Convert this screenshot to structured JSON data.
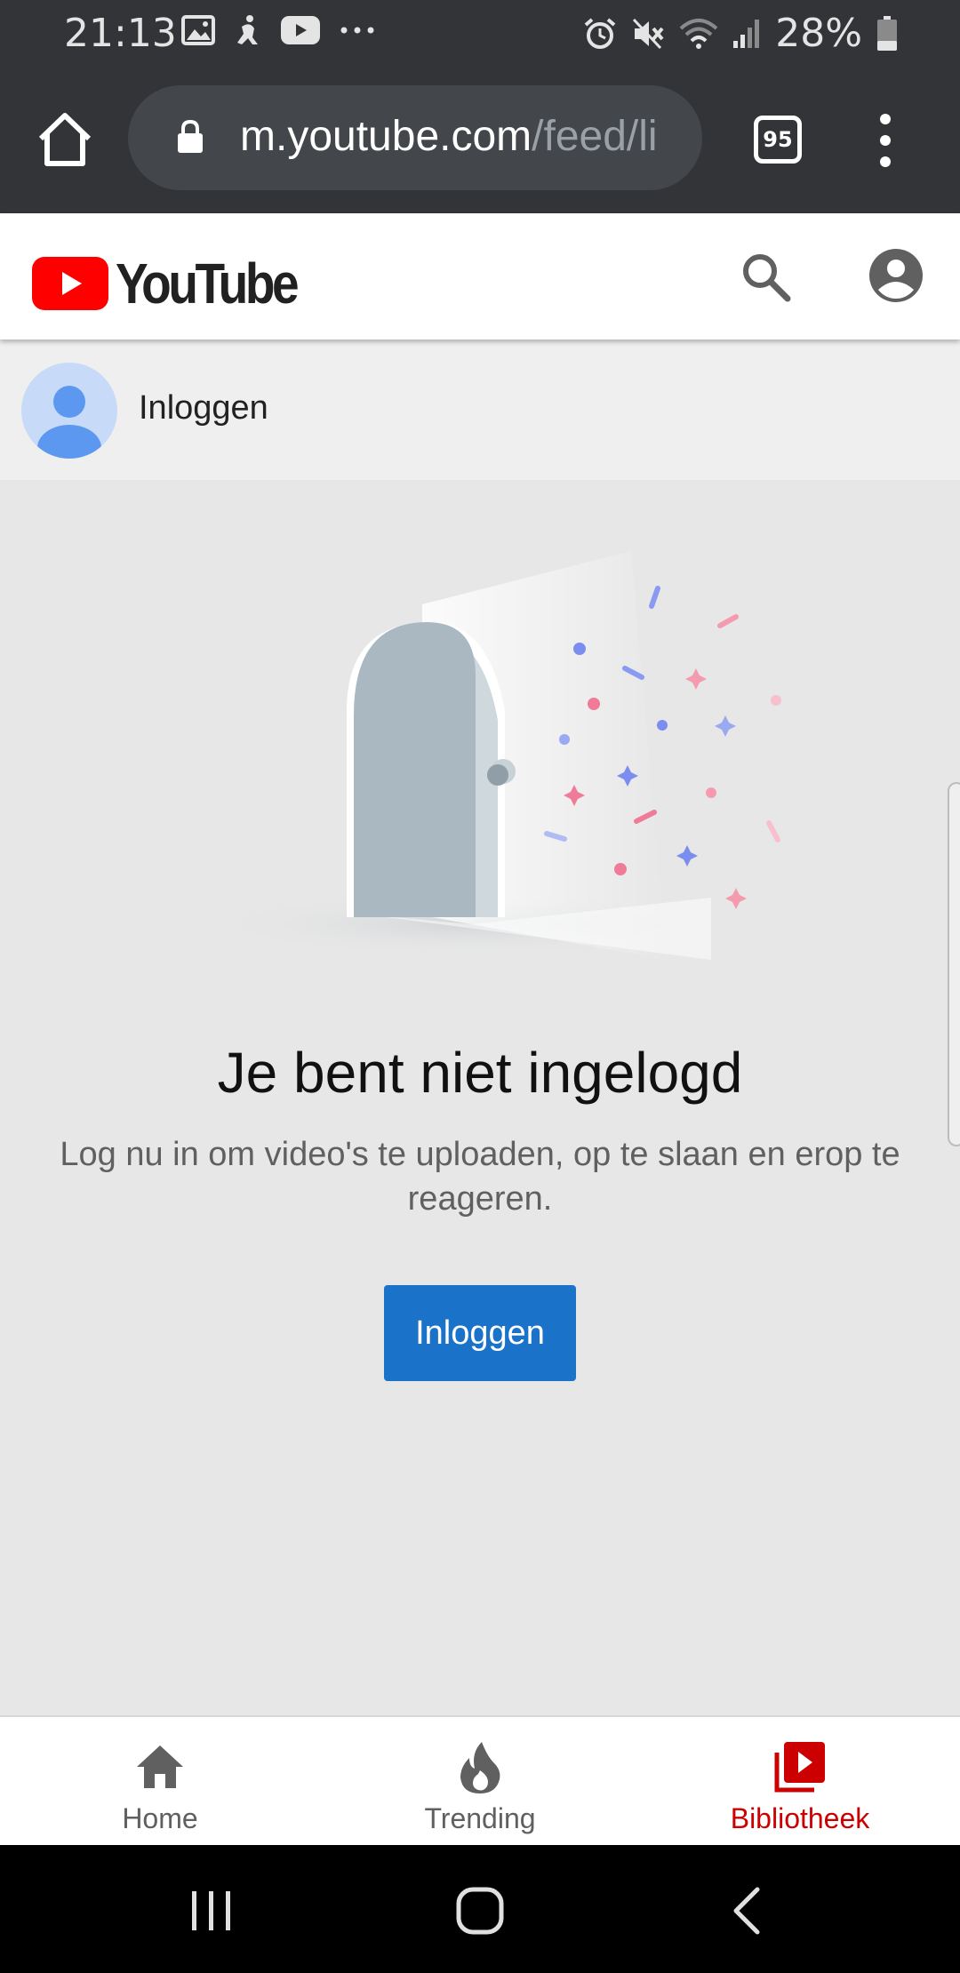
{
  "status_bar": {
    "time": "21:13",
    "battery": "28%",
    "left_icons": [
      "image-icon",
      "accessibility-icon",
      "youtube-icon",
      "more-icon"
    ],
    "right_icons": [
      "alarm-icon",
      "mute-icon",
      "wifi-icon",
      "signal-icon",
      "battery-icon"
    ]
  },
  "browser": {
    "url_domain": "m.youtube.com",
    "url_path": "/feed/li",
    "tab_count": "95"
  },
  "header": {
    "logo_text": "YouTube"
  },
  "signin_row": {
    "label": "Inloggen"
  },
  "empty_state": {
    "title": "Je bent niet ingelogd",
    "description": "Log nu in om video's te uploaden, op te slaan en erop te reageren.",
    "button_label": "Inloggen"
  },
  "bottom_nav": {
    "items": [
      {
        "label": "Home",
        "icon": "home-icon"
      },
      {
        "label": "Trending",
        "icon": "flame-icon"
      },
      {
        "label": "Bibliotheek",
        "icon": "library-icon",
        "active": true
      }
    ]
  },
  "colors": {
    "brand_red": "#ff0000",
    "active_nav": "#cc0000",
    "primary_button": "#1a73c9",
    "browser_chrome": "#323437"
  }
}
